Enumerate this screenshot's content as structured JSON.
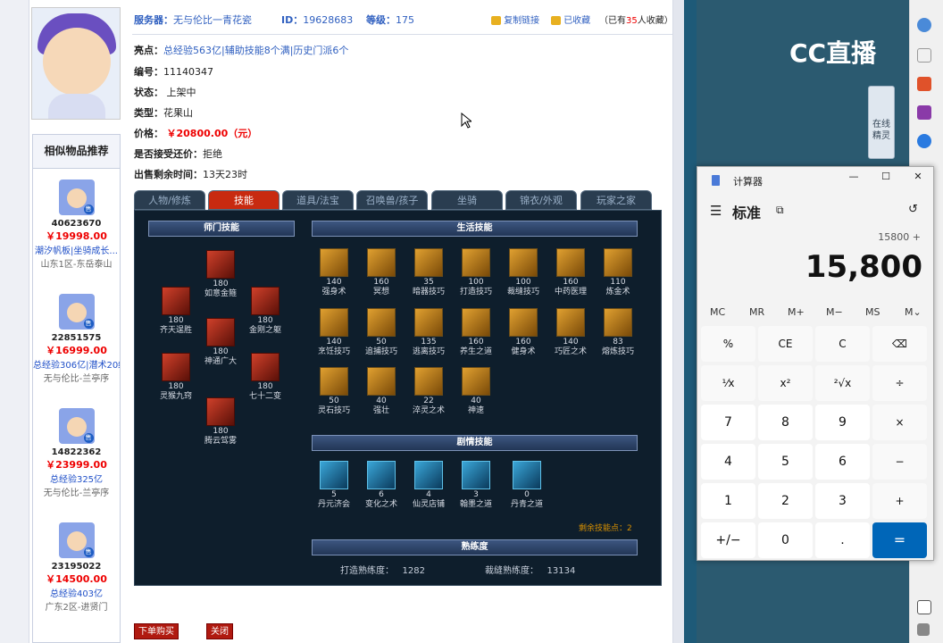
{
  "header": {
    "server_label": "服务器：",
    "server": "无与伦比一青花瓷",
    "id_label": "ID：",
    "id": "19628683",
    "level_label": "等级：",
    "level": "175",
    "copy_link": "复制链接",
    "favorited": "已收藏",
    "fav_prefix": "（已有",
    "fav_count": "35",
    "fav_suffix": "人收藏）"
  },
  "info": {
    "highlight_label": "亮点：",
    "highlight": "总经验563亿|辅助技能8个满|历史门派6个",
    "number_label": "编号：",
    "number": "11140347",
    "status_label": "状态：",
    "status": "上架中",
    "type_label": "类型：",
    "type": "花果山",
    "price_label": "价格：",
    "price": "￥20800.00（元）",
    "bargain_label": "是否接受还价：",
    "bargain": "拒绝",
    "remaining_label": "出售剩余时间：",
    "remaining": "13天23时"
  },
  "related": {
    "title": "相似物品推荐",
    "items": [
      {
        "id": "40623670",
        "price": "￥19998.00",
        "desc": "潮汐帆板|坐骑成长...",
        "server": "山东1区-东岳泰山",
        "tag": "售"
      },
      {
        "id": "22851575",
        "price": "￥16999.00",
        "desc": "总经验306亿|潜术20级",
        "server": "无与伦比-兰亭序",
        "tag": "售"
      },
      {
        "id": "14822362",
        "price": "￥23999.00",
        "desc": "总经验325亿",
        "server": "无与伦比-兰亭序",
        "tag": "售"
      },
      {
        "id": "23195022",
        "price": "￥14500.00",
        "desc": "总经验403亿",
        "server": "广东2区-进贤门",
        "tag": "售"
      }
    ]
  },
  "tabs": [
    "人物/修炼",
    "技能",
    "道具/法宝",
    "召唤兽/孩子",
    "坐骑",
    "锦衣/外观",
    "玩家之家"
  ],
  "skills": {
    "school_title": "师门技能",
    "life_title": "生活技能",
    "plot_title": "剧情技能",
    "prof_title": "熟练度",
    "school": [
      {
        "name": "如意金箍",
        "level": "180"
      },
      {
        "name": "齐天逞胜",
        "level": "180"
      },
      {
        "name": "神通广大",
        "level": "180"
      },
      {
        "name": "金刚之躯",
        "level": "180"
      },
      {
        "name": "灵猴九窍",
        "level": "180"
      },
      {
        "name": "七十二变",
        "level": "180"
      },
      {
        "name": "腾云驾雾",
        "level": "180"
      }
    ],
    "life": [
      {
        "name": "强身术",
        "level": "140"
      },
      {
        "name": "冥想",
        "level": "160"
      },
      {
        "name": "暗器技巧",
        "level": "35"
      },
      {
        "name": "打造技巧",
        "level": "100"
      },
      {
        "name": "裁缝技巧",
        "level": "100"
      },
      {
        "name": "中药医理",
        "level": "160"
      },
      {
        "name": "炼金术",
        "level": "110"
      },
      {
        "name": "烹饪技巧",
        "level": "140"
      },
      {
        "name": "追捕技巧",
        "level": "50"
      },
      {
        "name": "逃离技巧",
        "level": "135"
      },
      {
        "name": "养生之道",
        "level": "160"
      },
      {
        "name": "健身术",
        "level": "160"
      },
      {
        "name": "巧匠之术",
        "level": "140"
      },
      {
        "name": "熔炼技巧",
        "level": "83"
      },
      {
        "name": "灵石技巧",
        "level": "50"
      },
      {
        "name": "强壮",
        "level": "40"
      },
      {
        "name": "淬灵之术",
        "level": "22"
      },
      {
        "name": "神速",
        "level": "40"
      }
    ],
    "plot": [
      {
        "name": "丹元济会",
        "level": "5"
      },
      {
        "name": "变化之术",
        "level": "6"
      },
      {
        "name": "仙灵店铺",
        "level": "4"
      },
      {
        "name": "翰墨之道",
        "level": "3"
      },
      {
        "name": "丹青之道",
        "level": "0"
      }
    ],
    "remaining": "剩余技能点：2",
    "forge_label": "打造熟练度：",
    "forge": "1282",
    "sew_label": "裁缝熟练度：",
    "sew": "13134"
  },
  "buttons": {
    "buy": "下单购买",
    "close": "关闭"
  },
  "side": {
    "logo": "CC直播",
    "elf": "在线精灵"
  },
  "calculator": {
    "title": "计算器",
    "mode": "标准",
    "expression": "15800 +",
    "display": "15,800",
    "memory": [
      "MC",
      "MR",
      "M+",
      "M−",
      "MS",
      "M⌄"
    ],
    "keys": [
      "%",
      "CE",
      "C",
      "⌫",
      "¹⁄x",
      "x²",
      "²√x",
      "÷",
      "7",
      "8",
      "9",
      "×",
      "4",
      "5",
      "6",
      "−",
      "1",
      "2",
      "3",
      "+",
      "+/−",
      "0",
      ".",
      "="
    ],
    "min": "—",
    "max": "☐",
    "close": "✕"
  }
}
